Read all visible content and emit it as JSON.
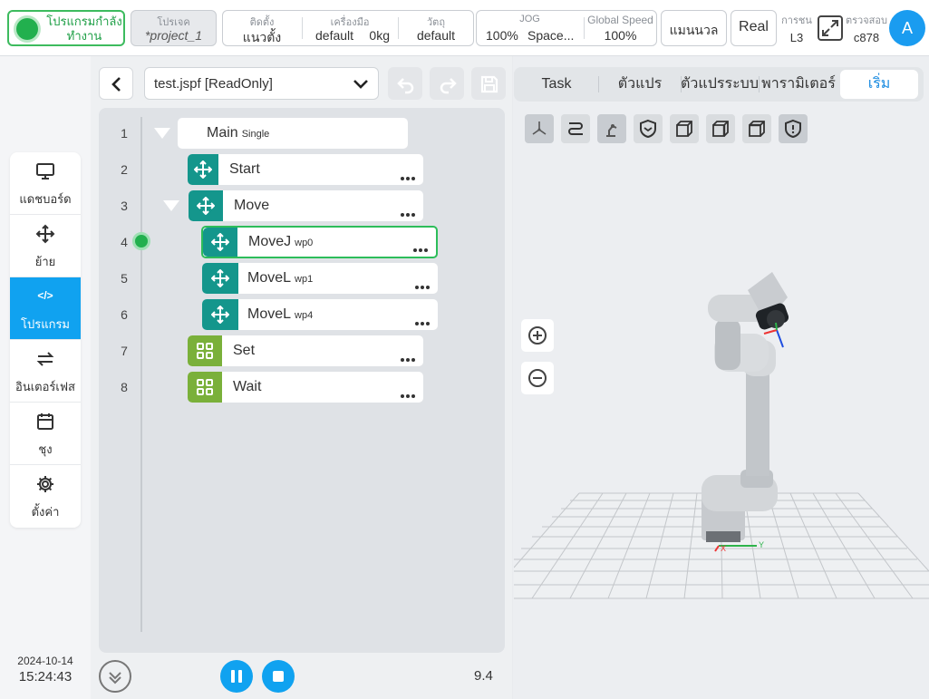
{
  "status": {
    "text": "โปรแกรมกำลังทำงาน"
  },
  "project": {
    "caption": "โปรเจค",
    "value": "*project_1"
  },
  "installation": {
    "setup_caption": "ติดตั้ง",
    "setup_value": "แนวตั้ง",
    "tool_caption": "เครื่องมือ",
    "tool_value": "default",
    "payload_value": "0kg",
    "object_caption": "วัตถุ",
    "object_value": "default"
  },
  "jog": {
    "caption": "JOG",
    "percent": "100%",
    "space": "Space...",
    "speed_caption": "Global Speed",
    "speed_value": "100%"
  },
  "mode": {
    "manual": "แมนนวล",
    "real": "Real"
  },
  "collision": {
    "caption": "การชน",
    "value": "L3"
  },
  "check": {
    "caption": "ตรวจสอบ",
    "value": "c878"
  },
  "user": {
    "initial": "A"
  },
  "sidebar": {
    "items": [
      {
        "label": "แดชบอร์ด",
        "icon": "monitor-icon"
      },
      {
        "label": "ย้าย",
        "icon": "move-icon"
      },
      {
        "label": "โปรแกรม",
        "icon": "code-icon",
        "code": "</>",
        "active": true
      },
      {
        "label": "อินเตอร์เฟส",
        "icon": "swap-icon"
      },
      {
        "label": "ชุง",
        "icon": "calendar-icon"
      },
      {
        "label": "ตั้งค่า",
        "icon": "gear-icon"
      }
    ],
    "date": "2024-10-14",
    "time": "15:24:43"
  },
  "program": {
    "file": "test.jspf [ReadOnly]",
    "lines": [
      "1",
      "2",
      "3",
      "4",
      "5",
      "6",
      "7",
      "8"
    ],
    "main": {
      "name": "Main",
      "tag": "Single"
    },
    "nodes": [
      {
        "name": "Start",
        "tag": ""
      },
      {
        "name": "Move",
        "tag": ""
      },
      {
        "name": "MoveJ",
        "tag": "wp0"
      },
      {
        "name": "MoveL",
        "tag": "wp1"
      },
      {
        "name": "MoveL",
        "tag": "wp4"
      },
      {
        "name": "Set",
        "tag": ""
      },
      {
        "name": "Wait",
        "tag": ""
      }
    ],
    "speed_readout": "9.4"
  },
  "right": {
    "tabs": [
      "Task",
      "ตัวแปร",
      "ตัวแปรระบบ",
      "พารามิเตอร์",
      "เริ่ม"
    ],
    "active_tab": "เริ่ม",
    "axis_x_label": "X",
    "axis_y_label": "Y"
  },
  "colors": {
    "accent": "#10a2f0",
    "teal": "#14968c",
    "olive": "#7ab03a",
    "running": "#22b04e"
  }
}
